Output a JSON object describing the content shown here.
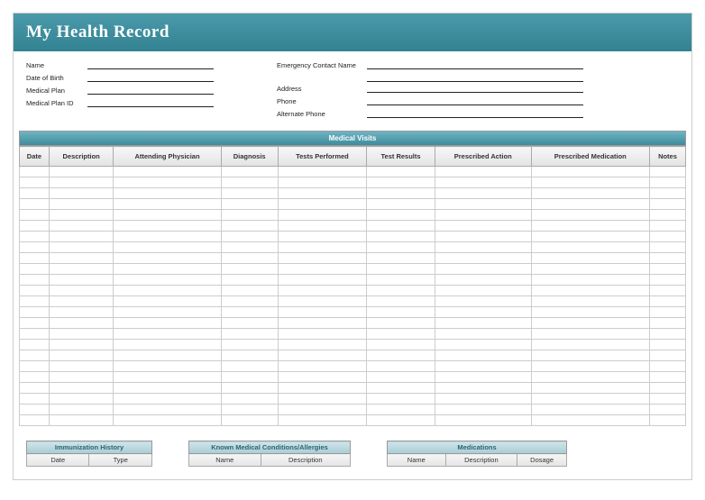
{
  "title": "My Health Record",
  "info_left": [
    {
      "label": "Name"
    },
    {
      "label": "Date of Birth"
    },
    {
      "label": "Medical Plan"
    },
    {
      "label": "Medical Plan ID"
    }
  ],
  "info_right": [
    {
      "label": "Emergency Contact Name"
    },
    {
      "label": "Address"
    },
    {
      "label": "Phone"
    },
    {
      "label": "Alternate Phone"
    }
  ],
  "visits": {
    "section_title": "Medical Visits",
    "columns": [
      "Date",
      "Description",
      "Attending Physician",
      "Diagnosis",
      "Tests Performed",
      "Test Results",
      "Prescribed Action",
      "Prescribed Medication",
      "Notes"
    ],
    "row_count": 24
  },
  "bottom": {
    "immunization": {
      "title": "Immunization History",
      "columns": [
        "Date",
        "Type"
      ],
      "widths": [
        70,
        70
      ]
    },
    "conditions": {
      "title": "Known Medical Conditions/Allergies",
      "columns": [
        "Name",
        "Description"
      ],
      "widths": [
        80,
        100
      ]
    },
    "medications": {
      "title": "Medications",
      "columns": [
        "Name",
        "Description",
        "Dosage"
      ],
      "widths": [
        65,
        80,
        55
      ]
    }
  }
}
